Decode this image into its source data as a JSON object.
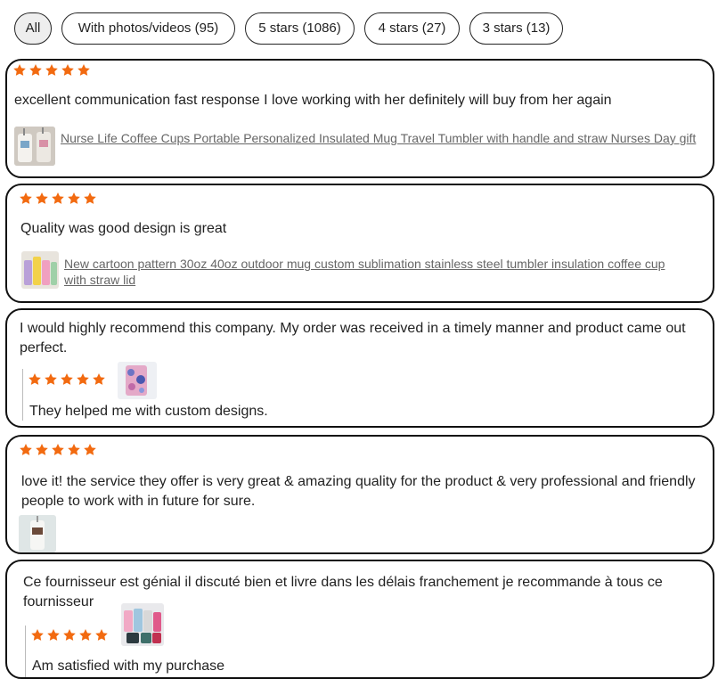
{
  "filters": [
    {
      "label": "All",
      "active": true
    },
    {
      "label": "With photos/videos (95)",
      "active": false
    },
    {
      "label": "5 stars (1086)",
      "active": false
    },
    {
      "label": "4 stars (27)",
      "active": false
    },
    {
      "label": "3 stars (13)",
      "active": false
    }
  ],
  "colors": {
    "star": "#f26a10",
    "border": "#111111",
    "link": "#666666"
  },
  "reviews": [
    {
      "rating": 5,
      "text": "excellent communication fast response I love working with her definitely will buy from her again",
      "product": "Nurse Life Coffee Cups Portable Personalized Insulated Mug Travel Tumbler with handle and straw Nurses Day gift"
    },
    {
      "rating": 5,
      "text": "Quality was good design is great",
      "product": "New cartoon pattern 30oz 40oz outdoor mug custom sublimation stainless steel tumbler insulation coffee cup with straw lid"
    },
    {
      "text": "I would highly recommend this company. My order was received in a timely manner and product came out perfect.",
      "reply_rating": 5,
      "reply_text": "They helped me with custom designs."
    },
    {
      "rating": 5,
      "text": "love it! the service they offer is very great & amazing quality for the product & very professional and friendly people to work with in future for sure."
    },
    {
      "text": "Ce fournisseur est génial il discuté bien et livre dans les délais franchement je recommande à tous ce fournisseur",
      "reply_rating": 5,
      "reply_text": "Am satisfied with my purchase"
    }
  ]
}
